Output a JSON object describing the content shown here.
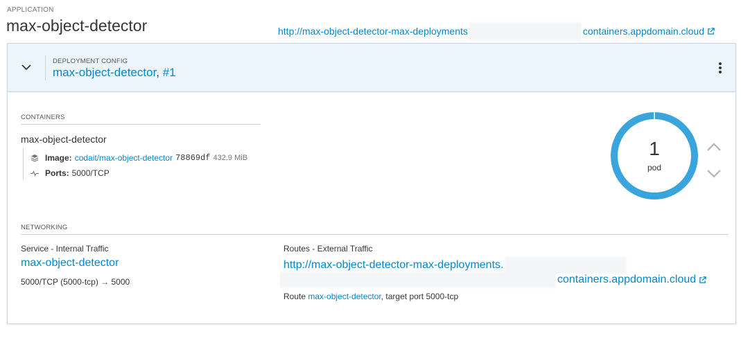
{
  "application": {
    "label": "APPLICATION",
    "name": "max-object-detector",
    "url_prefix": "http://max-object-detector-max-deployments",
    "url_suffix": "containers.appdomain.cloud"
  },
  "deployment": {
    "label": "DEPLOYMENT CONFIG",
    "name": "max-object-detector",
    "separator": ", ",
    "revision": "#1"
  },
  "containers": {
    "label": "CONTAINERS",
    "name": "max-object-detector",
    "image_label": "Image:",
    "image_name": "codait/max-object-detector",
    "image_hash": "78869df",
    "image_size": "432.9 MiB",
    "ports_label": "Ports:",
    "ports_value": "5000/TCP"
  },
  "pods": {
    "count": "1",
    "label": "pod",
    "ring_color": "#39a5dc"
  },
  "networking": {
    "label": "NETWORKING",
    "service_heading": "Service - Internal Traffic",
    "service_name": "max-object-detector",
    "service_ports": "5000/TCP (5000-tcp) → 5000",
    "routes_heading": "Routes - External Traffic",
    "route_url_prefix": "http://max-object-detector-max-deployments.",
    "route_url_suffix": "containers.appdomain.cloud",
    "route_prefix_text": "Route ",
    "route_name": "max-object-detector",
    "route_target_text": ", target port 5000-tcp"
  },
  "icons": {
    "external_link": "external-link-icon",
    "collapse": "chevron-down-icon",
    "kebab": "kebab-menu-icon",
    "image": "layers-icon",
    "ports": "pulse-icon",
    "scale_up": "chevron-up-icon",
    "scale_down": "chevron-down-icon"
  },
  "colors": {
    "link": "#0088ce",
    "header_bg": "#edf5fc"
  }
}
